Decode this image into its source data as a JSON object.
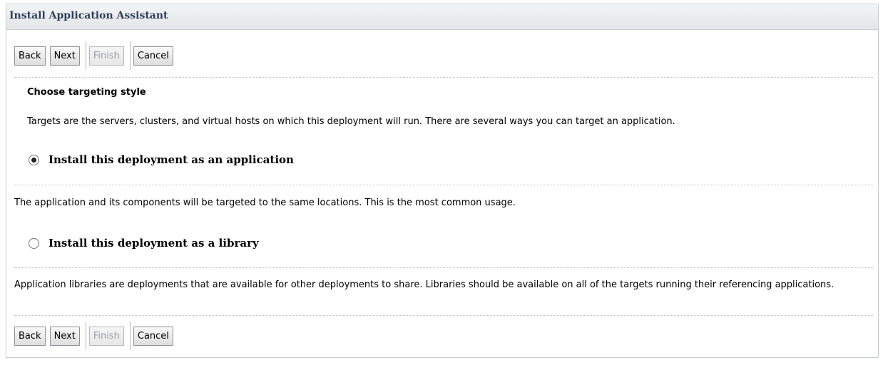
{
  "panel": {
    "title": "Install Application Assistant"
  },
  "toolbar_top": {
    "back": "Back",
    "next": "Next",
    "finish": "Finish",
    "cancel": "Cancel"
  },
  "toolbar_bottom": {
    "back": "Back",
    "next": "Next",
    "finish": "Finish",
    "cancel": "Cancel"
  },
  "section": {
    "heading": "Choose targeting style",
    "description": "Targets are the servers, clusters, and virtual hosts on which this deployment will run. There are several ways you can target an application."
  },
  "options": [
    {
      "label": "Install this deployment as an application",
      "selected": true,
      "description": "The application and its components will be targeted to the same locations. This is the most common usage."
    },
    {
      "label": "Install this deployment as a library",
      "selected": false,
      "description": "Application libraries are deployments that are available for other deployments to share. Libraries should be available on all of the targets running their referencing applications."
    }
  ]
}
